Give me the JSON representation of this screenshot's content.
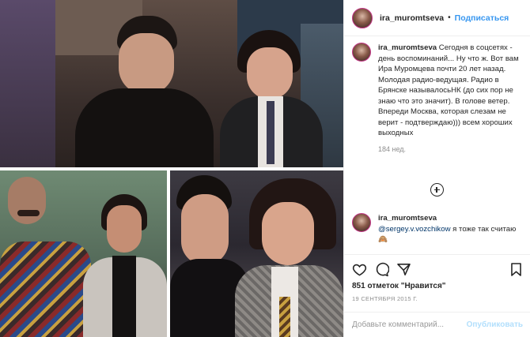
{
  "header": {
    "username": "ira_muromtseva",
    "separator": "•",
    "follow_label": "Подписаться"
  },
  "caption": {
    "username": "ira_muromtseva",
    "text": "Сегодня в соцсетях - день воспоминаний... Ну что ж. Вот вам Ира Муромцева почти 20 лет назад. Молодая радио-ведущая. Радио в Брянске называлосьНК (до сих пор не знаю что это значит). В голове ветер. Впереди Москва, которая слезам не верит - подтверждаю))) всем хороших выходных",
    "time": "184 нед."
  },
  "comment": {
    "username": "ira_muromtseva",
    "mention": "@sergey.v.vozchikow",
    "text": "я тоже так считаю",
    "emoji": "🙈"
  },
  "likes": {
    "count": "851 отметок",
    "label": "\"Нравится\""
  },
  "date": "19 СЕНТЯБРЯ 2015 Г.",
  "add_comment": {
    "placeholder": "Добавьте комментарий...",
    "publish_label": "Опубликовать"
  },
  "icons": {
    "heart": "heart-icon",
    "comment": "comment-icon",
    "share": "share-icon",
    "bookmark": "bookmark-icon",
    "load_more": "plus-circle-icon"
  },
  "colors": {
    "link": "#3897f0",
    "text": "#262626",
    "muted": "#8e8e8e",
    "mention": "#003569",
    "publish_disabled": "#b2dffc",
    "divider": "#efefef"
  }
}
